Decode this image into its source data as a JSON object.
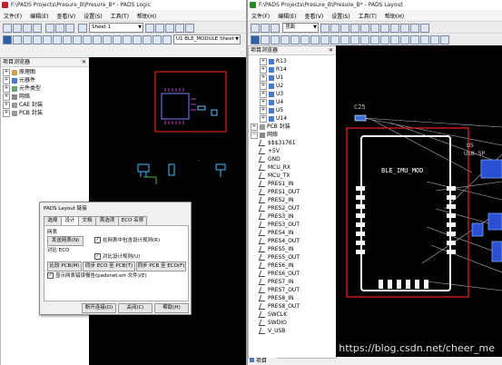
{
  "logic_window": {
    "title": "F:\\PADS Projects\\Presure_B\\Presure_B* - PADS Logic",
    "menu": [
      "文件(F)",
      "编辑(E)",
      "查看(V)",
      "设置(S)",
      "工具(T)",
      "帮助(H)"
    ],
    "sheet_select": "Sheet 1",
    "part_select": "U1 BLE_MODULE Sheet",
    "browser_title": "项目浏览器",
    "tree": [
      {
        "label": "原理图",
        "expand": "+"
      },
      {
        "label": "元器件",
        "expand": "+"
      },
      {
        "label": "元件类型",
        "expand": "+"
      },
      {
        "label": "网络",
        "expand": "+"
      },
      {
        "label": "CAE 封装",
        "expand": "+"
      },
      {
        "label": "PCB 封装",
        "expand": "+"
      }
    ]
  },
  "layout_window": {
    "title": "F:\\PADS Projects\\Presure_B\\Presure_B* - PADS Layout",
    "menu": [
      "文件(F)",
      "编辑(E)",
      "查看(V)",
      "设置(S)",
      "工具(T)",
      "帮助(H)"
    ],
    "layer_select": "顶面",
    "browser_title": "项目浏览器",
    "tree_top": [
      "R13",
      "R14",
      "U1",
      "U2",
      "U3",
      "U4",
      "U5",
      "U14"
    ],
    "pcb_pkg": "PCB 封装",
    "nets_label": "网络",
    "nets": [
      "$$$31761",
      "+5V",
      "GND",
      "MCU_RX",
      "MCU_TX",
      "PRES1_IN",
      "PRES1_OUT",
      "PRES2_IN",
      "PRES2_OUT",
      "PRES3_IN",
      "PRES3_OUT",
      "PRES4_IN",
      "PRES4_OUT",
      "PRES5_IN",
      "PRES5_OUT",
      "PRES6_IN",
      "PRES6_OUT",
      "PRES7_IN",
      "PRES7_OUT",
      "PRES8_IN",
      "PRES8_OUT",
      "SWCLK",
      "SWDIO",
      "V_USB"
    ],
    "bottom_tab": "项目",
    "board_labels": {
      "c25": "C25",
      "module": "BLE_IMU_MOD",
      "u5": "U5",
      "usb": "USB-5P"
    }
  },
  "dialog": {
    "title": "PADS Layout 链接",
    "tabs": [
      "选择",
      "设计",
      "文档",
      "首选项",
      "ECO 名称"
    ],
    "active_tab": "设计",
    "net_group": "网表",
    "send_netlist": "发送网表(N)",
    "include_rules": "在网表中包含设计规则(R)",
    "compare_eco": "对比 ECO",
    "compare_rules": "对比设计规则(U)",
    "compare_pcb": "比较 PCB(M)",
    "sync_eco_pcb": "同步 ECO 至 PCB(T)",
    "sync_pcb_eco": "同步 PCB 至 ECO(F)",
    "show_report": "显示网表错误报告(padsnet.err 文件)(E)",
    "btn_open": "断开连接(D)",
    "btn_close": "关闭(C)",
    "btn_help": "帮助(H)"
  },
  "watermark": "https://blog.csdn.net/cheer_me"
}
